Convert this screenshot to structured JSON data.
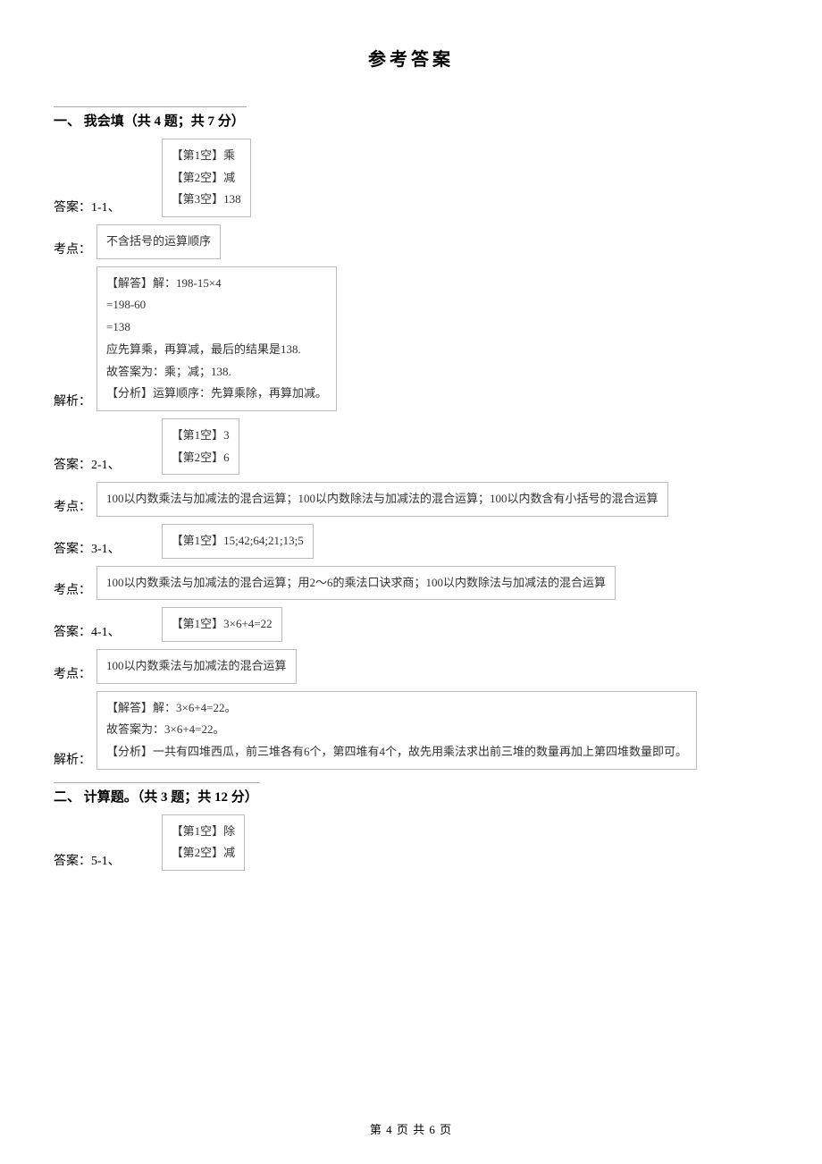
{
  "title": "参考答案",
  "section1": {
    "heading": "一、 我会填（共 4 题；共 7 分）",
    "q1": {
      "answer_label": "答案：1-1、",
      "lines": [
        "【第1空】乘",
        "【第2空】减",
        "【第3空】138"
      ],
      "kaodian_label": "考点：",
      "kaodian": "不含括号的运算顺序",
      "jiexi_label": "解析：",
      "jiexi_lines": [
        "【解答】解：198-15×4",
        "=198-60",
        "=138",
        "应先算乘，再算减，最后的结果是138.",
        "故答案为：乘；减；138.",
        "【分析】运算顺序：先算乘除，再算加减。"
      ]
    },
    "q2": {
      "answer_label": "答案：2-1、",
      "lines": [
        "【第1空】3",
        "【第2空】6"
      ],
      "kaodian_label": "考点：",
      "kaodian": "100以内数乘法与加减法的混合运算；100以内数除法与加减法的混合运算；100以内数含有小括号的混合运算"
    },
    "q3": {
      "answer_label": "答案：3-1、",
      "line": "【第1空】15;42;64;21;13;5",
      "kaodian_label": "考点：",
      "kaodian": "100以内数乘法与加减法的混合运算；用2～6的乘法口诀求商；100以内数除法与加减法的混合运算"
    },
    "q4": {
      "answer_label": "答案：4-1、",
      "line": "【第1空】3×6+4=22",
      "kaodian_label": "考点：",
      "kaodian": "100以内数乘法与加减法的混合运算",
      "jiexi_label": "解析：",
      "jiexi_lines": [
        "【解答】解：3×6+4=22。",
        "故答案为：3×6+4=22。",
        "【分析】一共有四堆西瓜，前三堆各有6个，第四堆有4个，故先用乘法求出前三堆的数量再加上第四堆数量即可。"
      ]
    }
  },
  "section2": {
    "heading": "二、 计算题。（共 3 题；共 12 分）",
    "q5": {
      "answer_label": "答案：5-1、",
      "lines": [
        "【第1空】除",
        "【第2空】减"
      ]
    }
  },
  "footer": "第 4 页 共 6 页"
}
